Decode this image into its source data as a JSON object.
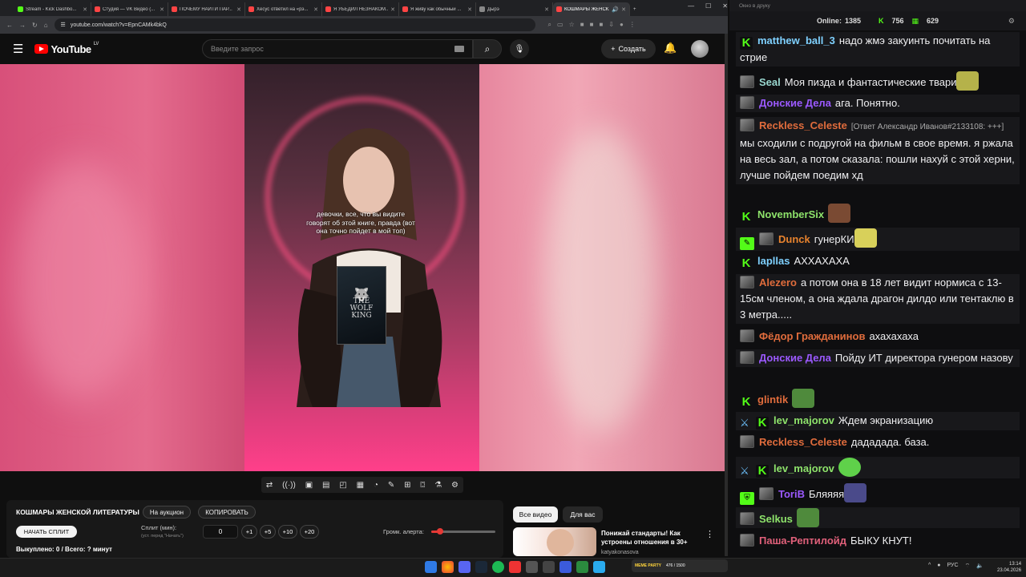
{
  "browser": {
    "tabs": [
      {
        "label": "Stream - Kick Dashbo...",
        "color": "#53fc18",
        "active": false
      },
      {
        "label": "Студия — VK Видео (...",
        "color": "#ff4444",
        "active": false
      },
      {
        "label": "ПОЧЕМУ НАЙТИ ПАР...",
        "color": "#ff4444",
        "active": false
      },
      {
        "label": "Хесус ответил на «рэ...",
        "color": "#ff4444",
        "active": false
      },
      {
        "label": "Я УБЕДИЛ НЕЗНАКОМ...",
        "color": "#ff4444",
        "active": false
      },
      {
        "label": "Я живу как обычный ...",
        "color": "#ff4444",
        "active": false
      },
      {
        "label": "Дырэ",
        "color": "#888888",
        "active": false
      },
      {
        "label": "КОШМАРЫ ЖЕНСК...",
        "color": "#ff4444",
        "active": true
      }
    ],
    "url": "youtube.com/watch?v=EpnCAMk4bkQ"
  },
  "youtube": {
    "logo_text": "YouTube",
    "logo_region": "LV",
    "search_placeholder": "Введите запрос",
    "create_label": "Создать"
  },
  "video": {
    "caption": "девочки, все, что вы видите говорят об этой книге, правда (вот она точно пойдет в мой топ)",
    "book_title": "THE WOLF KING"
  },
  "panel": {
    "title": "КОШМАРЫ ЖЕНСКОЙ ЛИТЕРАТУРЫ",
    "auction_label": "На аукцион",
    "copy_label": "КОПИРОВАТЬ",
    "split_button": "НАЧАТЬ СПЛИТ",
    "split_label": "Сплит (мин):",
    "split_hint": "(уст. перед \"Начать\")",
    "split_value": "0",
    "increments": [
      "+1",
      "+5",
      "+10",
      "+20"
    ],
    "volume_label": "Громк. алерта:",
    "volume_level": 0.14,
    "sold_text": "Выкуплено: 0 / Всего: ? минут"
  },
  "recs": {
    "chip_all": "Все видео",
    "chip_for_you": "Для вас",
    "video_title": "Понижай стандарты! Как устроены отношения в 30+",
    "channel": "katyakonasova"
  },
  "chat": {
    "window_title": "Окно в друку",
    "online_label": "Online:",
    "online_count": "1385",
    "kick_count": "756",
    "other_count": "629",
    "messages": [
      {
        "nick": "matthew_ball_3",
        "color": "#7fd1ff",
        "text": "надо жмэ закуинть почитать на стрие"
      },
      {
        "nick": "Seal",
        "color": "#9ad8d0",
        "text": "Моя пизда и фантастические твари"
      },
      {
        "nick": "Донские Дела",
        "color": "#9b59ff",
        "text": "ага. Понятно."
      },
      {
        "nick": "Reckless_Celeste",
        "color": "#e06c3c",
        "meta": "[Ответ Александр Иванов#2133108: +++]",
        "text": "мы сходили с подругой на фильм в свое время. я ржала на весь зал, а потом сказала: пошли нахуй с этой херни, лучше пойдем поедим хд"
      },
      {
        "nick": "NovemberSix",
        "color": "#8ee36b",
        "text": ""
      },
      {
        "nick": "Dunck",
        "color": "#e8832e",
        "text": "гунерКИ"
      },
      {
        "nick": "lapllas",
        "color": "#7fd1ff",
        "text": "АХХАХАХА"
      },
      {
        "nick": "Alezero",
        "color": "#e06c3c",
        "text": "а потом она в 18 лет видит нормиса с 13-15см членом, а она ждала драгон дилдо или тентаклю в 3 метра....."
      },
      {
        "nick": "Фёдор Гражданинов",
        "color": "#e06c3c",
        "text": "ахахахаха"
      },
      {
        "nick": "Донские Дела",
        "color": "#9b59ff",
        "text": "Пойду ИТ директора гунером назову"
      },
      {
        "nick": "glintik",
        "color": "#e06c3c",
        "text": ""
      },
      {
        "nick": "lev_majorov",
        "color": "#8ee36b",
        "text": "Ждем экранизацию"
      },
      {
        "nick": "Reckless_Celeste",
        "color": "#e06c3c",
        "text": "дададада. база."
      },
      {
        "nick": "lev_majorov",
        "color": "#8ee36b",
        "text": ""
      },
      {
        "nick": "ToriB",
        "color": "#9b59ff",
        "text": "Бляяяя"
      },
      {
        "nick": "Selkus",
        "color": "#8ee36b",
        "text": ""
      },
      {
        "nick": "Паша-Рептилойд",
        "color": "#e0607a",
        "text": "БЫКУ КНУТ!"
      }
    ]
  },
  "taskbar": {
    "meme_label": "MEME PARTY",
    "meme_progress": "476 / 1500",
    "lang": "РУС",
    "time": "13:14",
    "date": "23.04.2026"
  }
}
